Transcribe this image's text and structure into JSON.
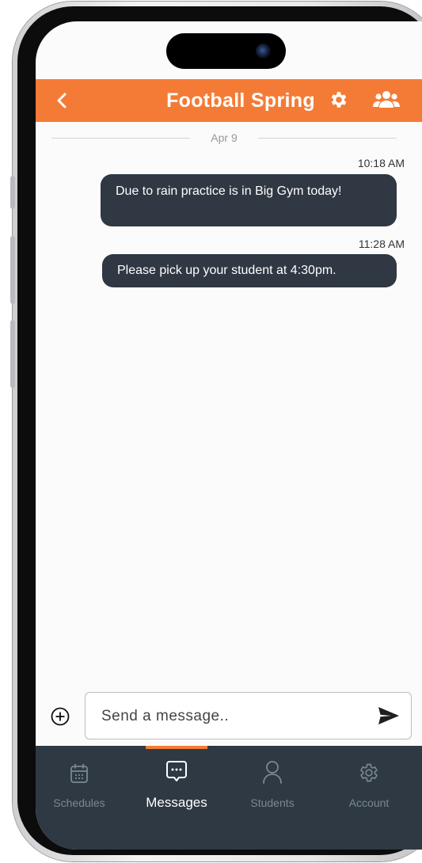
{
  "header": {
    "title": "Football Spring",
    "back_icon": "chevron-left-icon",
    "settings_icon": "gear-icon",
    "members_icon": "users-icon",
    "color": "#f47b36"
  },
  "conversation": {
    "date_label": "Apr 9",
    "messages": [
      {
        "time": "10:18 AM",
        "text": "Due to rain practice is in Big Gym today!"
      },
      {
        "time": "11:28 AM",
        "text": "Please pick up your student at 4:30pm."
      }
    ],
    "bubble_color": "#2f3843"
  },
  "composer": {
    "attach_icon": "plus-circle-icon",
    "placeholder": "Send a message..",
    "value": "",
    "send_icon": "send-icon"
  },
  "tabbar": {
    "active_tab": "Messages",
    "active_color": "#f47b36",
    "tabs": [
      {
        "label": "Schedules",
        "icon": "calendar-icon"
      },
      {
        "label": "Messages",
        "icon": "chat-bubble-icon"
      },
      {
        "label": "Students",
        "icon": "person-icon"
      },
      {
        "label": "Account",
        "icon": "gear-icon"
      }
    ]
  }
}
